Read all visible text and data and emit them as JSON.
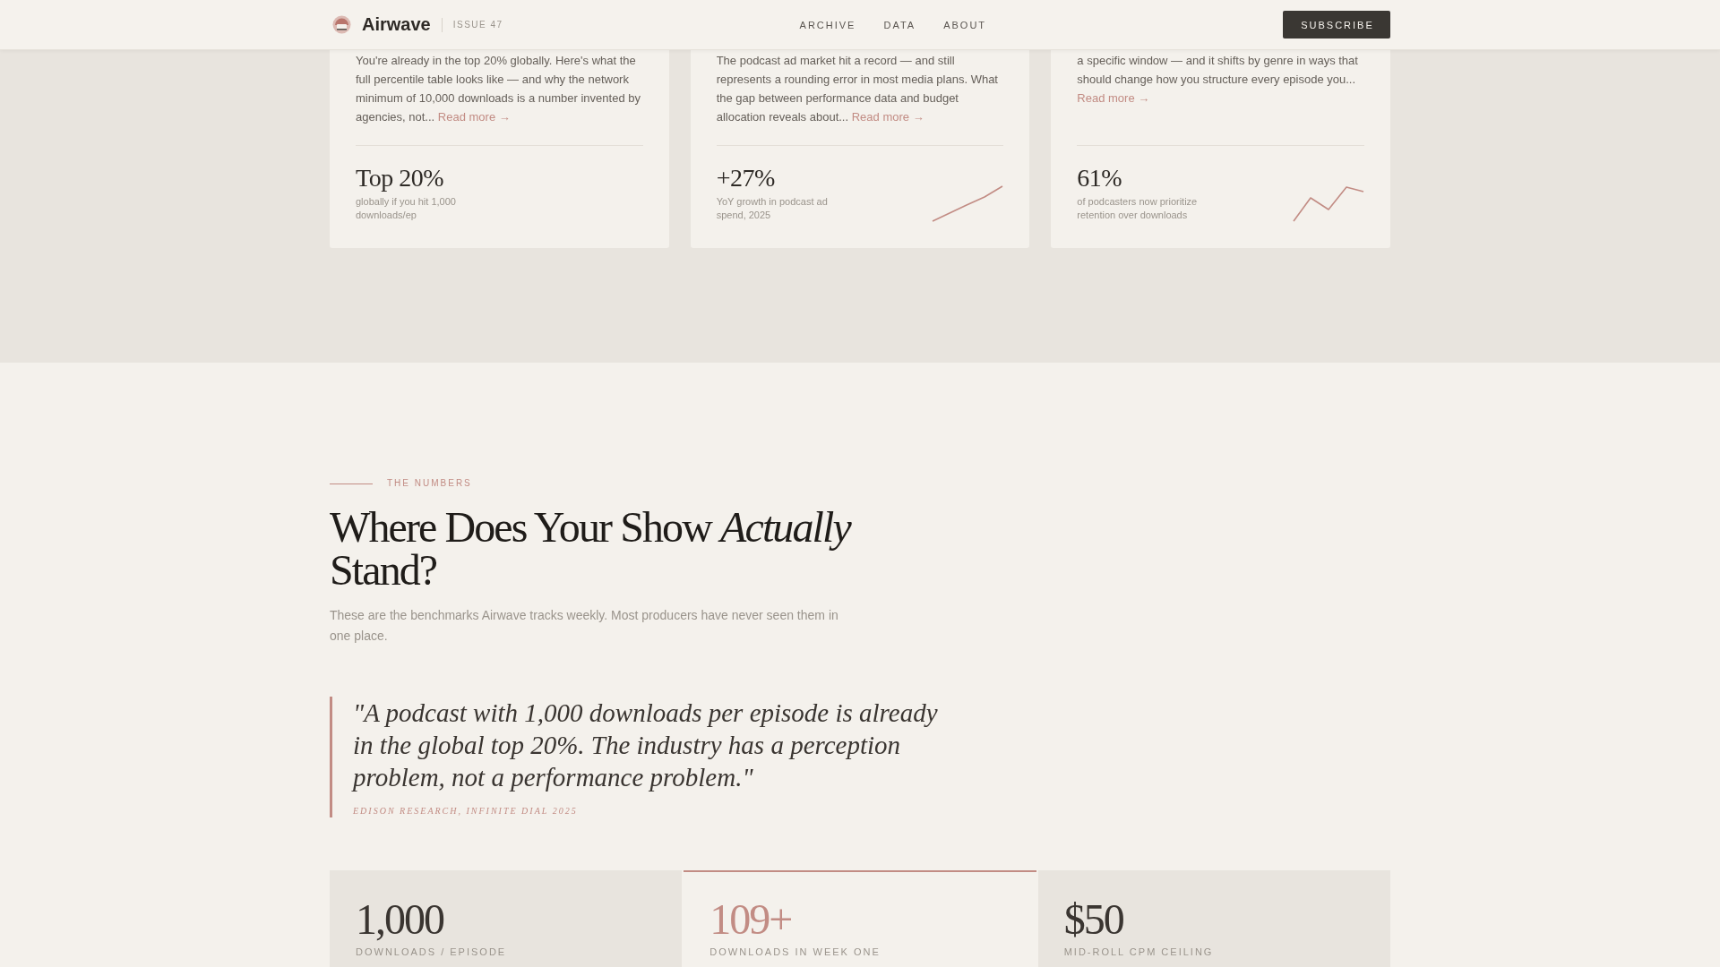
{
  "header": {
    "brand": "Airwave",
    "issue": "ISSUE 47",
    "nav": [
      "ARCHIVE",
      "DATA",
      "ABOUT"
    ],
    "button": "SUBSCRIBE"
  },
  "articles": [
    {
      "kind": "plain",
      "excerpt": "You're already in the top 20% globally. Here's what the full percentile table looks like — and why the network minimum of 10,000 downloads is a number invented by agencies, not...",
      "link": "Read more →",
      "stat": "Top 20%",
      "caption": "globally if you hit 1,000 downloads/ep"
    },
    {
      "kind": "rising",
      "excerpt": "The podcast ad market hit a record — and still represents a rounding error in most media plans. What the gap between performance data and budget allocation reveals about...",
      "link": "Read more →",
      "stat": "+27%",
      "caption": "YoY growth in podcast ad spend, 2025"
    },
    {
      "kind": "zigzag",
      "excerpt": "a specific window — and it shifts by genre in ways that should change how you structure every episode you...",
      "link": "Read more →",
      "stat": "61%",
      "caption": "of podcasters now prioritize retention over downloads"
    }
  ],
  "numbers": {
    "eyebrow": "THE NUMBERS",
    "heading": "Where Does Your Show *Actually* Stand?",
    "intro": "These are the benchmarks Airwave tracks weekly. Most producers have never seen them in one place.",
    "quote": {
      "text": "\"A podcast with 1,000 downloads per episode is already in the global top 20%. The industry has a perception problem, not a performance problem.\"",
      "cite": "EDISON RESEARCH, INFINITE DIAL 2025"
    },
    "stats": [
      {
        "value": "1,000",
        "label": "DOWNLOADS / EPISODE",
        "highlighted": false
      },
      {
        "value": "109+",
        "label": "DOWNLOADS IN WEEK ONE",
        "highlighted": true
      },
      {
        "value": "$50",
        "label": "MID-ROLL CPM CEILING",
        "highlighted": false
      }
    ]
  }
}
